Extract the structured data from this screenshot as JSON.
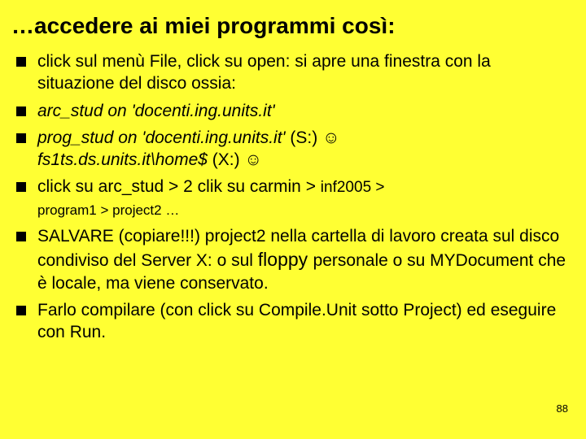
{
  "title": "…accedere ai miei programmi così:",
  "items": {
    "i1": "click sul menù File, click su open: si apre una finestra con la situazione del disco ossia:",
    "i2": "arc_stud on 'docenti.ing.units.it'",
    "i3a": "prog_stud on 'docenti.ing.units.it'",
    "i3b": " (S:) ",
    "smile1": "☺",
    "i3c": "fs1ts.ds.units.it\\home$ ",
    "i3d": " (X:) ",
    "smile2": "☺",
    "i4a": "click su arc_stud > 2 clik su carmin > ",
    "i4b": "inf2005 > ",
    "i4c": "program1 > project2 …",
    "i5a": "SALVARE (copiare!!!) project2 nella cartella di lavoro creata sul disco condiviso del Server X: o sul ",
    "i5b": "floppy ",
    "i5c": "personale o su MYDocument che è locale, ma viene conservato.",
    "i6": "Farlo compilare (con click su Compile.Unit sotto Project) ed eseguire con Run."
  },
  "page_number": "88"
}
